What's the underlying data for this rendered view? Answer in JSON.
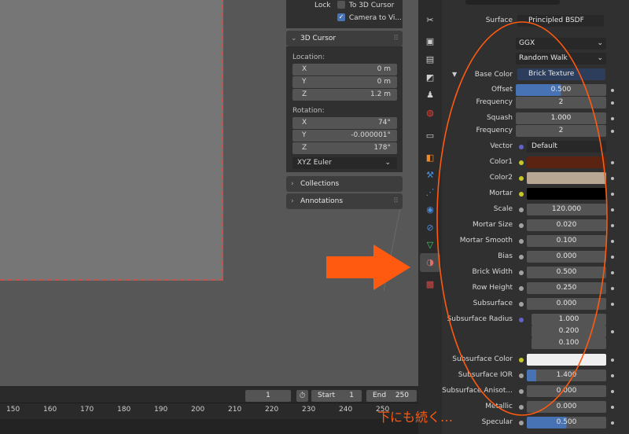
{
  "viewport": {
    "lock_label": "Lock",
    "to_3d_cursor": "To 3D Cursor",
    "camera_to_view": "Camera to Vi...",
    "cursor_panel_title": "3D Cursor",
    "location_label": "Location:",
    "location": [
      {
        "k": "X",
        "v": "0 m"
      },
      {
        "k": "Y",
        "v": "0 m"
      },
      {
        "k": "Z",
        "v": "1.2 m"
      }
    ],
    "rotation_label": "Rotation:",
    "rotation": [
      {
        "k": "X",
        "v": "74°"
      },
      {
        "k": "Y",
        "v": "-0.000001°"
      },
      {
        "k": "Z",
        "v": "178°"
      }
    ],
    "rotation_mode": "XYZ Euler",
    "collections_title": "Collections",
    "annotations_title": "Annotations"
  },
  "timeline": {
    "current_frame": "1",
    "start_label": "Start",
    "start_value": "1",
    "end_label": "End",
    "end_value": "250",
    "ticks": [
      "150",
      "160",
      "170",
      "180",
      "190",
      "200",
      "210",
      "220",
      "230",
      "240",
      "250"
    ]
  },
  "props": {
    "surface_label": "Surface",
    "surface_value": "Principled BSDF",
    "distribution": "GGX",
    "subsurface_method": "Random Walk",
    "base_color_label": "Base Color",
    "base_color_value": "Brick Texture",
    "offset_label": "Offset",
    "offset_value": "0.500",
    "frequency1_label": "Frequency",
    "frequency1_value": "2",
    "squash_label": "Squash",
    "squash_value": "1.000",
    "frequency2_label": "Frequency",
    "frequency2_value": "2",
    "vector_label": "Vector",
    "vector_value": "Default",
    "color1_label": "Color1",
    "color2_label": "Color2",
    "mortar_label": "Mortar",
    "scale_label": "Scale",
    "scale_value": "120.000",
    "mortar_size_label": "Mortar Size",
    "mortar_size_value": "0.020",
    "mortar_smooth_label": "Mortar Smooth",
    "mortar_smooth_value": "0.100",
    "bias_label": "Bias",
    "bias_value": "0.000",
    "brick_width_label": "Brick Width",
    "brick_width_value": "0.500",
    "row_height_label": "Row Height",
    "row_height_value": "0.250",
    "subsurface_label": "Subsurface",
    "subsurface_value": "0.000",
    "subsurface_radius_label": "Subsurface Radius",
    "subsurface_radius_values": [
      "1.000",
      "0.200",
      "0.100"
    ],
    "subsurface_color_label": "Subsurface Color",
    "subsurface_ior_label": "Subsurface IOR",
    "subsurface_ior_value": "1.400",
    "subsurface_aniso_label": "Subsurface Anisot...",
    "subsurface_aniso_value": "0.000",
    "metallic_label": "Metallic",
    "metallic_value": "0.000",
    "specular_label": "Specular",
    "specular_value": "0.500"
  },
  "annotation": {
    "text": "下にも続く…",
    "color": "#ff5a10"
  },
  "colors": {
    "color1": "#5a2312",
    "color2": "#b8a792",
    "mortar": "#000000",
    "subsurface_color": "#efefef",
    "accent_blue": "#4772b3",
    "socket_yellow": "#c7c729",
    "socket_gray": "#a1a1a1",
    "socket_purple": "#6363c7",
    "arrow": "#ff5a10"
  }
}
